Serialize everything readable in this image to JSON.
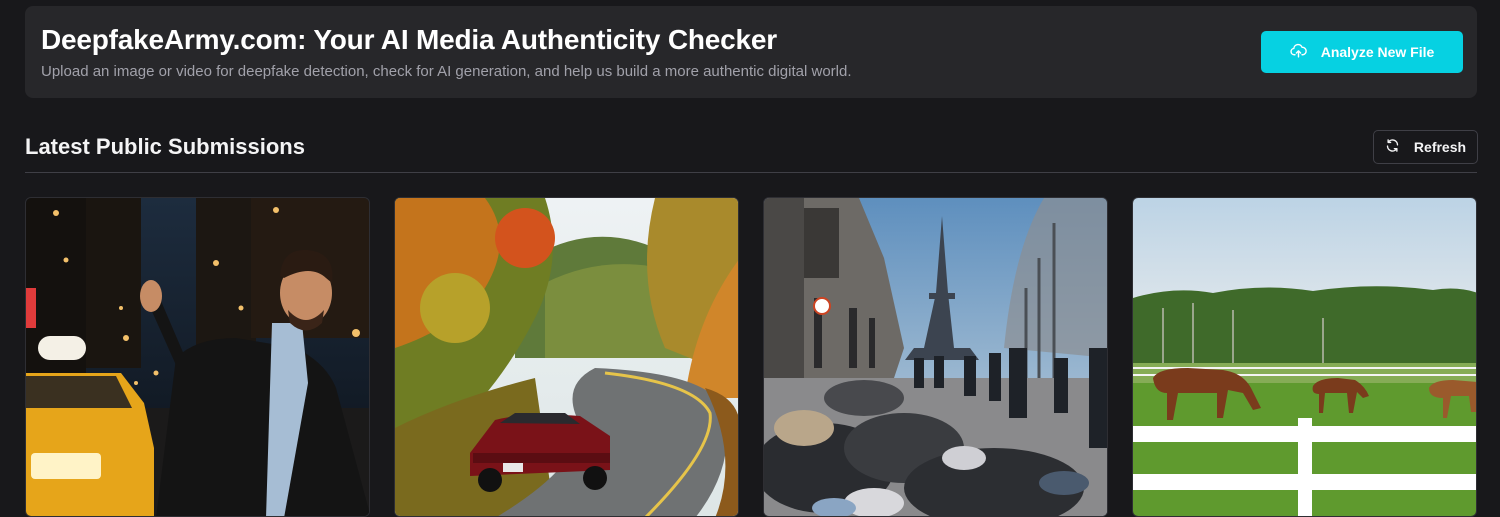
{
  "header": {
    "title": "DeepfakeArmy.com: Your AI Media Authenticity Checker",
    "subtitle": "Upload an image or video for deepfake detection, check for AI generation, and help us build a more authentic digital world.",
    "analyze_label": "Analyze New File",
    "analyze_icon": "cloud-upload-icon",
    "accent": "#06d1e2"
  },
  "submissions": {
    "title": "Latest Public Submissions",
    "refresh_label": "Refresh",
    "refresh_icon": "refresh-icon",
    "cards": [
      {
        "image": "man-hailing-taxi-night-city"
      },
      {
        "image": "red-car-winding-autumn-road"
      },
      {
        "image": "paris-street-trash-eiffel-tower"
      },
      {
        "image": "horses-grazing-fenced-pasture"
      }
    ]
  }
}
